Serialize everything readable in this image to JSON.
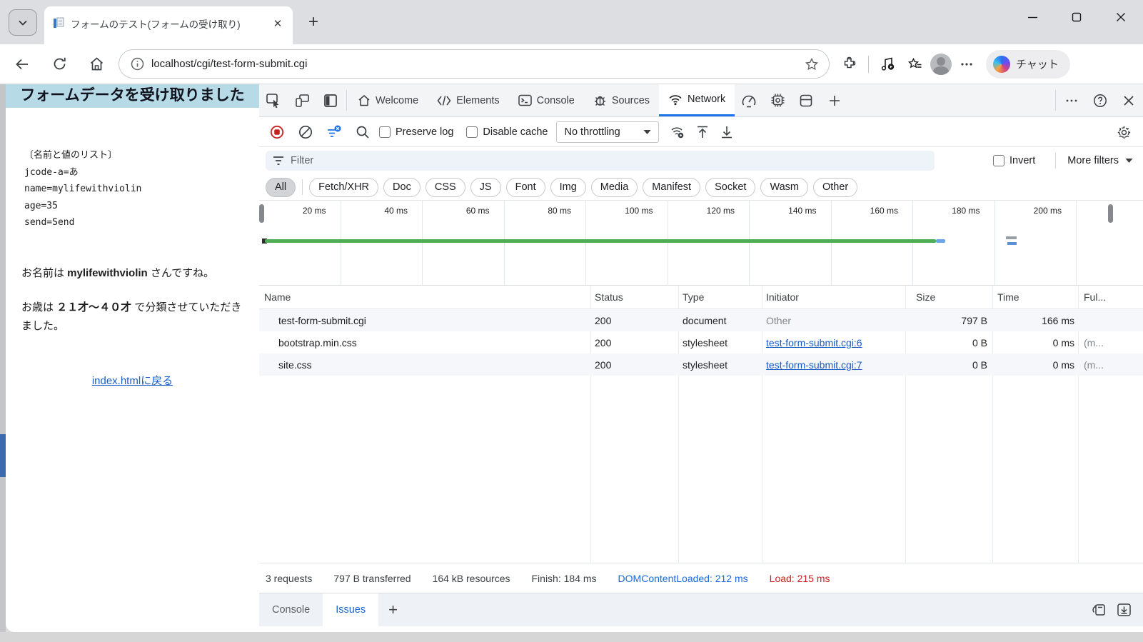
{
  "browser": {
    "tab_title": "フォームのテスト(フォームの受け取り)",
    "url": "localhost/cgi/test-form-submit.cgi",
    "copilot_label": "チャット"
  },
  "page": {
    "heading": "フォームデータを受け取りました",
    "list_title": "〔名前と値のリスト〕",
    "list_items": [
      "jcode-a=あ",
      "name=mylifewithviolin",
      "age=35",
      "send=Send"
    ],
    "name_line": {
      "prefix": "お名前は ",
      "bold": "mylifewithviolin",
      "suffix": " さんですね。"
    },
    "age_line": {
      "prefix": "お歳は ",
      "bold": "２１才～４０才",
      "suffix": " で分類させていただきました。"
    },
    "back_link": "index.htmlに戻る"
  },
  "devtools": {
    "tabs": {
      "welcome": "Welcome",
      "elements": "Elements",
      "console": "Console",
      "sources": "Sources",
      "network": "Network"
    },
    "active_tab": "Network",
    "toolbar": {
      "preserve_log": "Preserve log",
      "disable_cache": "Disable cache",
      "throttling": "No throttling"
    },
    "filter_row": {
      "placeholder": "Filter",
      "invert": "Invert",
      "more_filters": "More filters"
    },
    "chips": [
      "All",
      "Fetch/XHR",
      "Doc",
      "CSS",
      "JS",
      "Font",
      "Img",
      "Media",
      "Manifest",
      "Socket",
      "Wasm",
      "Other"
    ],
    "active_chip": "All",
    "timeline_ticks": [
      "20 ms",
      "40 ms",
      "60 ms",
      "80 ms",
      "100 ms",
      "120 ms",
      "140 ms",
      "160 ms",
      "180 ms",
      "200 ms"
    ],
    "table": {
      "headers": [
        "Name",
        "Status",
        "Type",
        "Initiator",
        "Size",
        "Time",
        "Ful..."
      ],
      "rows": [
        {
          "name": "test-form-submit.cgi",
          "status": "200",
          "type": "document",
          "initiator": "Other",
          "initiator_is_link": false,
          "size": "797 B",
          "time": "166 ms",
          "fulfilled": ""
        },
        {
          "name": "bootstrap.min.css",
          "status": "200",
          "type": "stylesheet",
          "initiator": "test-form-submit.cgi:6",
          "initiator_is_link": true,
          "size": "0 B",
          "time": "0 ms",
          "fulfilled": "(m..."
        },
        {
          "name": "site.css",
          "status": "200",
          "type": "stylesheet",
          "initiator": "test-form-submit.cgi:7",
          "initiator_is_link": true,
          "size": "0 B",
          "time": "0 ms",
          "fulfilled": "(m..."
        }
      ]
    },
    "summary": [
      {
        "text": "3 requests",
        "color": "default"
      },
      {
        "text": "797 B transferred",
        "color": "default"
      },
      {
        "text": "164 kB resources",
        "color": "default"
      },
      {
        "text": "Finish: 184 ms",
        "color": "default"
      },
      {
        "text": "DOMContentLoaded: 212 ms",
        "color": "blue"
      },
      {
        "text": "Load: 215 ms",
        "color": "red"
      }
    ],
    "drawer_tabs": [
      "Console",
      "Issues"
    ],
    "drawer_active_tab": "Issues"
  },
  "colors": {
    "accent_blue": "#1a73e8",
    "timeline_green": "#4fae55",
    "load_red": "#c5221f",
    "link_blue": "#1659c2",
    "heading_bg": "#b6dbe7"
  }
}
